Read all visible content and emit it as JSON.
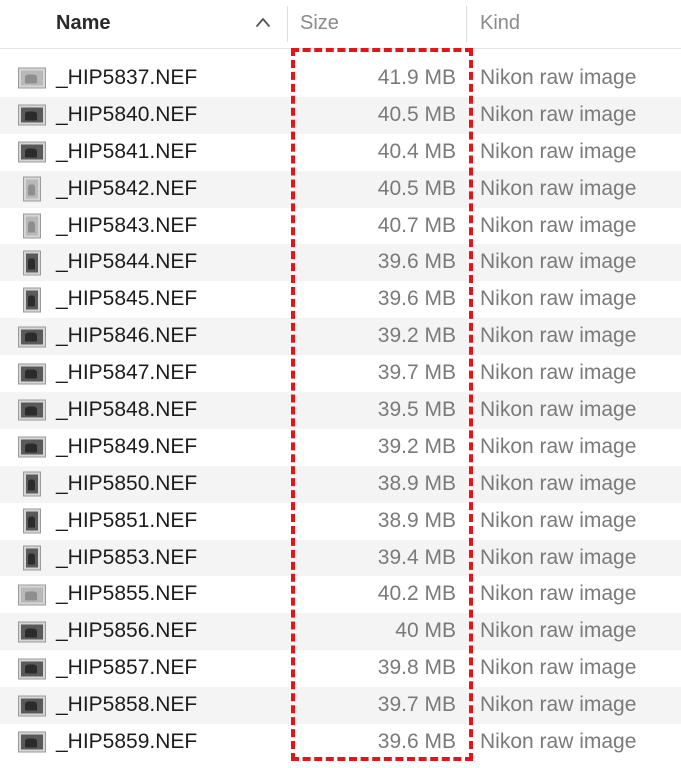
{
  "header": {
    "name_label": "Name",
    "size_label": "Size",
    "kind_label": "Kind",
    "sort_indicator": "chevron-up-icon"
  },
  "files": [
    {
      "name": "_HIP5837.NEF",
      "size": "41.9 MB",
      "kind": "Nikon raw image",
      "thumb": "landscape-light"
    },
    {
      "name": "_HIP5840.NEF",
      "size": "40.5 MB",
      "kind": "Nikon raw image",
      "thumb": "landscape"
    },
    {
      "name": "_HIP5841.NEF",
      "size": "40.4 MB",
      "kind": "Nikon raw image",
      "thumb": "landscape"
    },
    {
      "name": "_HIP5842.NEF",
      "size": "40.5 MB",
      "kind": "Nikon raw image",
      "thumb": "portrait-light"
    },
    {
      "name": "_HIP5843.NEF",
      "size": "40.7 MB",
      "kind": "Nikon raw image",
      "thumb": "portrait-light"
    },
    {
      "name": "_HIP5844.NEF",
      "size": "39.6 MB",
      "kind": "Nikon raw image",
      "thumb": "portrait"
    },
    {
      "name": "_HIP5845.NEF",
      "size": "39.6 MB",
      "kind": "Nikon raw image",
      "thumb": "portrait"
    },
    {
      "name": "_HIP5846.NEF",
      "size": "39.2 MB",
      "kind": "Nikon raw image",
      "thumb": "landscape"
    },
    {
      "name": "_HIP5847.NEF",
      "size": "39.7 MB",
      "kind": "Nikon raw image",
      "thumb": "landscape"
    },
    {
      "name": "_HIP5848.NEF",
      "size": "39.5 MB",
      "kind": "Nikon raw image",
      "thumb": "landscape"
    },
    {
      "name": "_HIP5849.NEF",
      "size": "39.2 MB",
      "kind": "Nikon raw image",
      "thumb": "landscape"
    },
    {
      "name": "_HIP5850.NEF",
      "size": "38.9 MB",
      "kind": "Nikon raw image",
      "thumb": "portrait"
    },
    {
      "name": "_HIP5851.NEF",
      "size": "38.9 MB",
      "kind": "Nikon raw image",
      "thumb": "portrait"
    },
    {
      "name": "_HIP5853.NEF",
      "size": "39.4 MB",
      "kind": "Nikon raw image",
      "thumb": "portrait"
    },
    {
      "name": "_HIP5855.NEF",
      "size": "40.2 MB",
      "kind": "Nikon raw image",
      "thumb": "landscape-light"
    },
    {
      "name": "_HIP5856.NEF",
      "size": "40 MB",
      "kind": "Nikon raw image",
      "thumb": "landscape"
    },
    {
      "name": "_HIP5857.NEF",
      "size": "39.8 MB",
      "kind": "Nikon raw image",
      "thumb": "landscape"
    },
    {
      "name": "_HIP5858.NEF",
      "size": "39.7 MB",
      "kind": "Nikon raw image",
      "thumb": "landscape"
    },
    {
      "name": "_HIP5859.NEF",
      "size": "39.6 MB",
      "kind": "Nikon raw image",
      "thumb": "landscape"
    }
  ],
  "colors": {
    "highlight": "#e0161b",
    "alt_row": "#f4f4f4"
  }
}
